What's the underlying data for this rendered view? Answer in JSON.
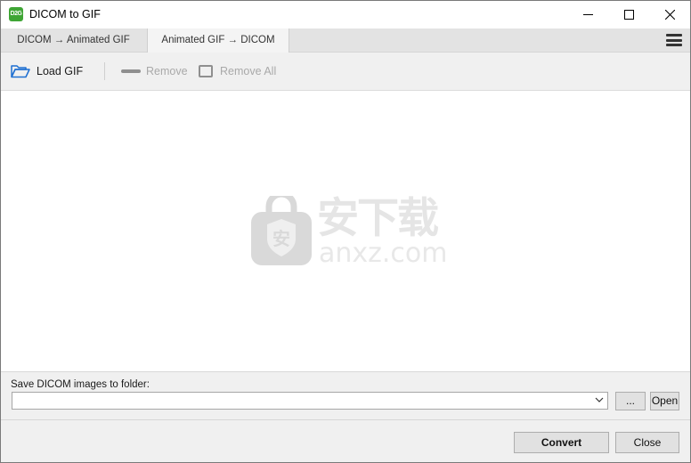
{
  "window": {
    "icon_text": "D2G",
    "title": "DICOM to GIF",
    "minimize_glyph": "—",
    "maximize_glyph": "☐",
    "close_glyph": "✕"
  },
  "tabs": [
    {
      "label": "DICOM → Animated GIF",
      "active": false
    },
    {
      "label": "Animated GIF → DICOM",
      "active": true
    }
  ],
  "toolbar": {
    "load_label": "Load GIF",
    "remove_label": "Remove",
    "remove_all_label": "Remove All"
  },
  "watermark": {
    "cn_text": "安下载",
    "en_text": "anxz.com",
    "shield_text": "安"
  },
  "save": {
    "label": "Save DICOM images to folder:",
    "folder_value": "",
    "browse_label": "...",
    "open_label": "Open"
  },
  "footer": {
    "convert_label": "Convert",
    "close_label": "Close"
  },
  "colors": {
    "accent_green": "#3fa535",
    "icon_blue": "#1e6fd1",
    "disabled_text": "#a9a9a9"
  },
  "icons": {
    "load": "folder-open-icon",
    "remove": "minus-icon",
    "remove_all": "checkbox-icon",
    "menu": "hamburger-menu-icon",
    "dropdown": "chevron-down-icon"
  }
}
